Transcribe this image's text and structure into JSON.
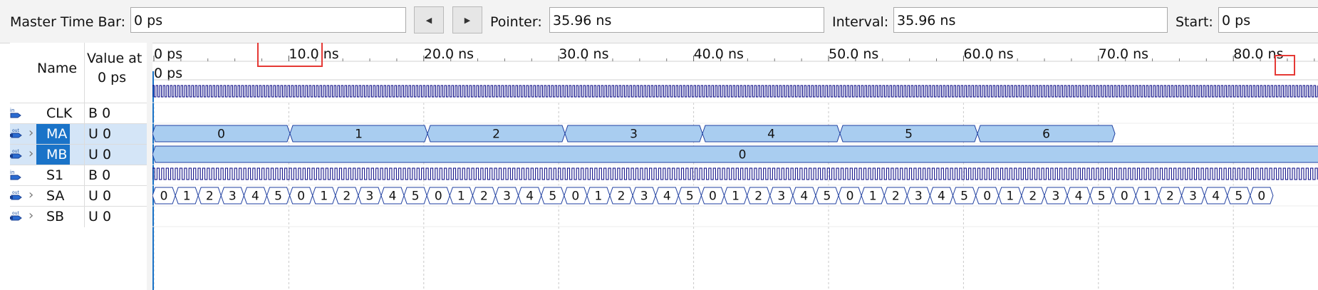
{
  "toolbar": {
    "master_label": "Master Time Bar:",
    "master_value": "0 ps",
    "prev_glyph": "◀",
    "next_glyph": "▶",
    "pointer_label": "Pointer:",
    "pointer_value": "35.96 ns",
    "interval_label": "Interval:",
    "interval_value": "35.96 ns",
    "start_label": "Start:",
    "start_value": "0 ps"
  },
  "columns": {
    "name": "Name",
    "value_line1": "Value at",
    "value_line2": "0 ps"
  },
  "time_axis": {
    "ticks": [
      "0 ps",
      "10.0 ns",
      "20.0 ns",
      "30.0 ns",
      "40.0 ns",
      "50.0 ns",
      "60.0 ns",
      "70.0 ns",
      "80.0 ns"
    ],
    "origin": "0 ps"
  },
  "signals": [
    {
      "name": "CLK",
      "value": "B 0",
      "pin": "in",
      "expandable": false,
      "selected": false
    },
    {
      "name": "MA",
      "value": "U 0",
      "pin": "out",
      "expandable": true,
      "selected": true
    },
    {
      "name": "MB",
      "value": "U 0",
      "pin": "out",
      "expandable": true,
      "selected": true
    },
    {
      "name": "S1",
      "value": "B 0",
      "pin": "in",
      "expandable": false,
      "selected": false
    },
    {
      "name": "SA",
      "value": "U 0",
      "pin": "out",
      "expandable": true,
      "selected": false
    },
    {
      "name": "SB",
      "value": "U 0",
      "pin": "out",
      "expandable": true,
      "selected": false
    }
  ],
  "bus_waves": {
    "MA": [
      "0",
      "1",
      "2",
      "3",
      "4",
      "5",
      "6"
    ],
    "MB": [
      "0"
    ],
    "SA": [
      "0",
      "1",
      "2",
      "3",
      "4",
      "5",
      "0",
      "1",
      "2",
      "3",
      "4",
      "5",
      "0",
      "1",
      "2",
      "3",
      "4",
      "5",
      "0",
      "1",
      "2",
      "3",
      "4",
      "5",
      "0",
      "1",
      "2",
      "3",
      "4",
      "5",
      "0",
      "1",
      "2",
      "3",
      "4",
      "5",
      "0",
      "1",
      "2",
      "3",
      "4",
      "5",
      "0",
      "1",
      "2",
      "3",
      "4",
      "5",
      "0"
    ]
  },
  "colors": {
    "bus_fill": "#a9cdf0",
    "bus_line": "#1f3fa0",
    "wave_line": "#000080",
    "highlight": "#e53935",
    "selected": "#1a73c8"
  }
}
